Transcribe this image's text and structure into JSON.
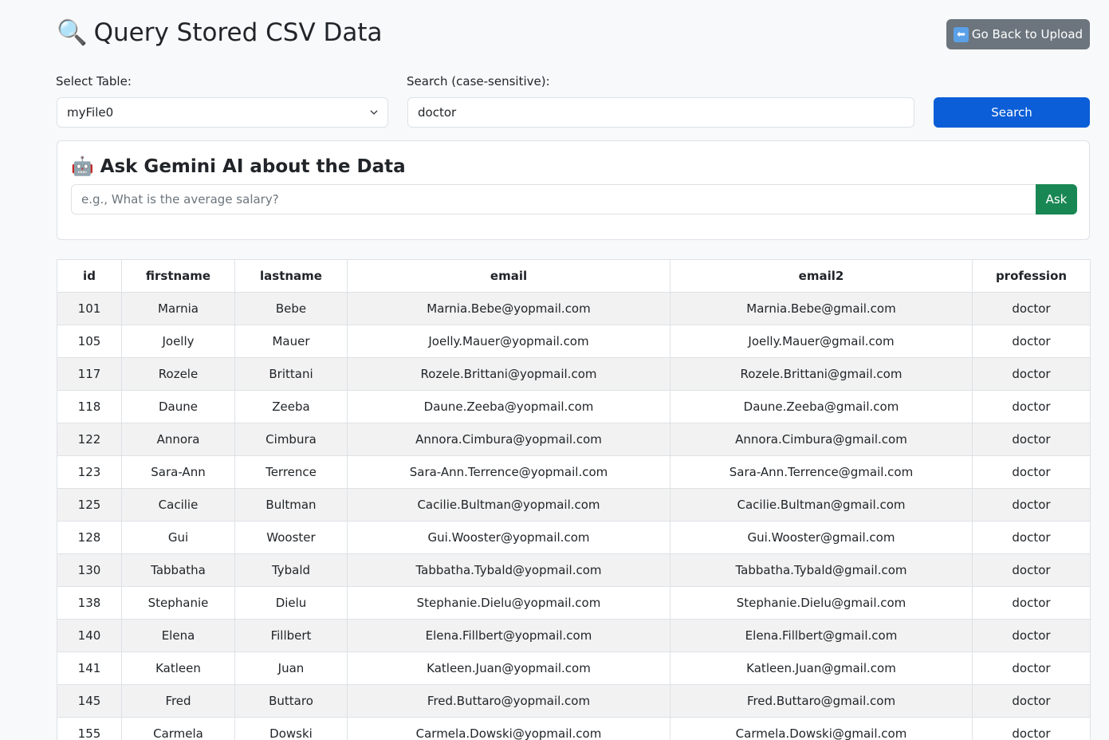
{
  "header": {
    "title": "Query Stored CSV Data",
    "title_icon": "🔍",
    "back_button_label": "Go Back to Upload",
    "back_button_icon": "⬅"
  },
  "filters": {
    "select_label": "Select Table:",
    "selected_table": "myFile0",
    "search_label": "Search (case-sensitive):",
    "search_value": "doctor",
    "search_button_label": "Search"
  },
  "ai": {
    "title": "Ask Gemini AI about the Data",
    "title_icon": "🤖",
    "placeholder": "e.g., What is the average salary?",
    "ask_button_label": "Ask"
  },
  "table": {
    "columns": [
      "id",
      "firstname",
      "lastname",
      "email",
      "email2",
      "profession"
    ],
    "rows": [
      [
        "101",
        "Marnia",
        "Bebe",
        "Marnia.Bebe@yopmail.com",
        "Marnia.Bebe@gmail.com",
        "doctor"
      ],
      [
        "105",
        "Joelly",
        "Mauer",
        "Joelly.Mauer@yopmail.com",
        "Joelly.Mauer@gmail.com",
        "doctor"
      ],
      [
        "117",
        "Rozele",
        "Brittani",
        "Rozele.Brittani@yopmail.com",
        "Rozele.Brittani@gmail.com",
        "doctor"
      ],
      [
        "118",
        "Daune",
        "Zeeba",
        "Daune.Zeeba@yopmail.com",
        "Daune.Zeeba@gmail.com",
        "doctor"
      ],
      [
        "122",
        "Annora",
        "Cimbura",
        "Annora.Cimbura@yopmail.com",
        "Annora.Cimbura@gmail.com",
        "doctor"
      ],
      [
        "123",
        "Sara-Ann",
        "Terrence",
        "Sara-Ann.Terrence@yopmail.com",
        "Sara-Ann.Terrence@gmail.com",
        "doctor"
      ],
      [
        "125",
        "Cacilie",
        "Bultman",
        "Cacilie.Bultman@yopmail.com",
        "Cacilie.Bultman@gmail.com",
        "doctor"
      ],
      [
        "128",
        "Gui",
        "Wooster",
        "Gui.Wooster@yopmail.com",
        "Gui.Wooster@gmail.com",
        "doctor"
      ],
      [
        "130",
        "Tabbatha",
        "Tybald",
        "Tabbatha.Tybald@yopmail.com",
        "Tabbatha.Tybald@gmail.com",
        "doctor"
      ],
      [
        "138",
        "Stephanie",
        "Dielu",
        "Stephanie.Dielu@yopmail.com",
        "Stephanie.Dielu@gmail.com",
        "doctor"
      ],
      [
        "140",
        "Elena",
        "Fillbert",
        "Elena.Fillbert@yopmail.com",
        "Elena.Fillbert@gmail.com",
        "doctor"
      ],
      [
        "141",
        "Katleen",
        "Juan",
        "Katleen.Juan@yopmail.com",
        "Katleen.Juan@gmail.com",
        "doctor"
      ],
      [
        "145",
        "Fred",
        "Buttaro",
        "Fred.Buttaro@yopmail.com",
        "Fred.Buttaro@gmail.com",
        "doctor"
      ],
      [
        "155",
        "Carmela",
        "Dowski",
        "Carmela.Dowski@yopmail.com",
        "Carmela.Dowski@gmail.com",
        "doctor"
      ]
    ]
  }
}
